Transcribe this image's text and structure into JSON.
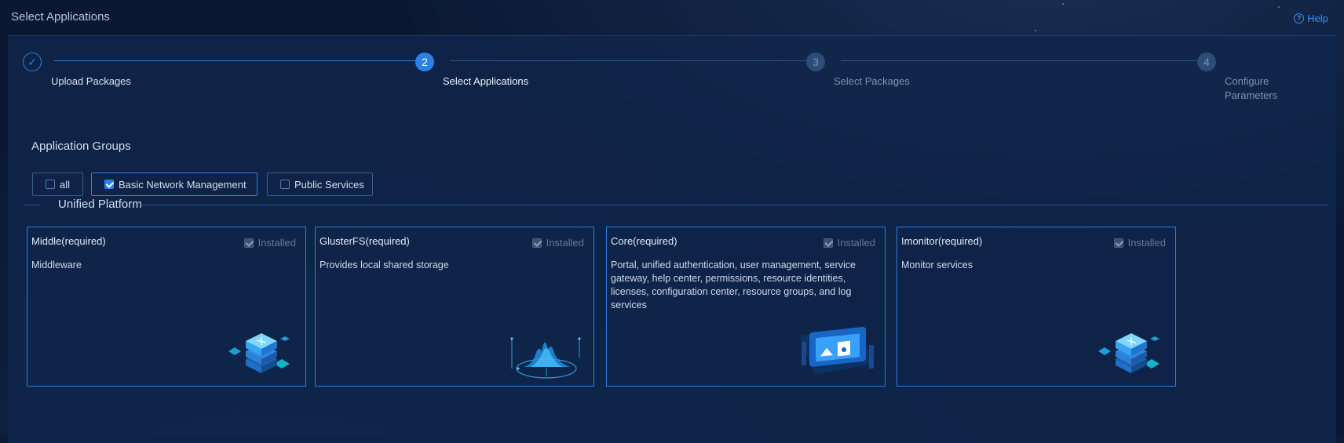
{
  "page": {
    "title": "Select Applications",
    "help_label": "Help"
  },
  "steps": [
    {
      "number": "✓",
      "label": "Upload Packages",
      "state": "done"
    },
    {
      "number": "2",
      "label": "Select Applications",
      "state": "active"
    },
    {
      "number": "3",
      "label": "Select Packages",
      "state": "todo"
    },
    {
      "number": "4",
      "label": "Configure Parameters",
      "state": "todo"
    }
  ],
  "groups": {
    "title": "Application Groups",
    "items": [
      {
        "label": "all",
        "checked": false
      },
      {
        "label": "Basic Network Management",
        "checked": true
      },
      {
        "label": "Public Services",
        "checked": false
      }
    ]
  },
  "section": {
    "title": "Unified Platform"
  },
  "cards": [
    {
      "title": "Middle(required)",
      "installed_label": "Installed",
      "desc": "Middleware",
      "illustration": "stacked-cubes"
    },
    {
      "title": "GlusterFS(required)",
      "installed_label": "Installed",
      "desc": "Provides local shared storage",
      "illustration": "storage-waves"
    },
    {
      "title": "Core(required)",
      "installed_label": "Installed",
      "desc": "Portal, unified authentication, user management, service gateway, help center, permissions, resource identities, licenses, configuration center, resource groups, and log services",
      "illustration": "portal-screen"
    },
    {
      "title": "Imonitor(required)",
      "installed_label": "Installed",
      "desc": "Monitor services",
      "illustration": "stacked-cubes"
    }
  ],
  "colors": {
    "accent": "#2f80e4",
    "background": "#0b1a36"
  }
}
